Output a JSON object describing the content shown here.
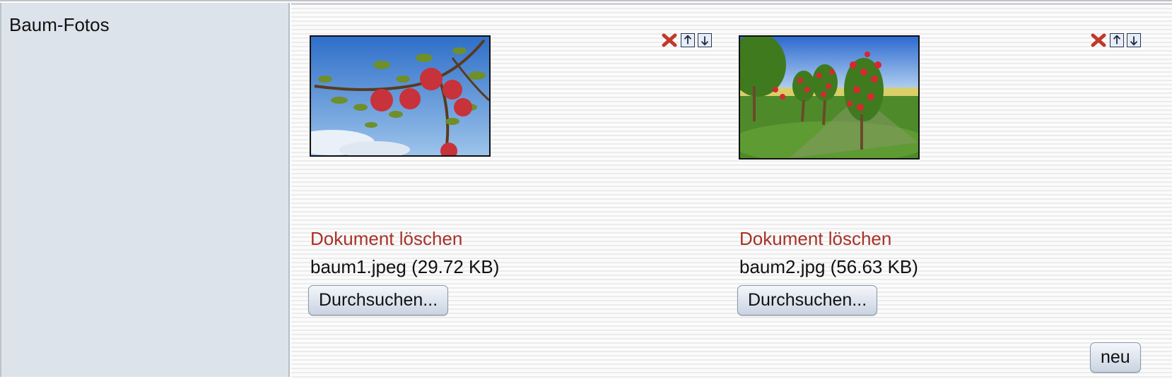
{
  "field": {
    "label": "Baum-Fotos"
  },
  "documents": [
    {
      "image_desc": "apple branch with red apples against blue sky",
      "delete_label": "Dokument löschen",
      "file_info": "baum1.jpeg (29.72 KB)",
      "browse_label": "Durchsuchen...",
      "icons": [
        "delete-x-icon",
        "move-up-icon",
        "move-down-icon"
      ]
    },
    {
      "image_desc": "young apple trees with red apples in orchard",
      "delete_label": "Dokument löschen",
      "file_info": "baum2.jpg (56.63 KB)",
      "browse_label": "Durchsuchen...",
      "icons": [
        "delete-x-icon",
        "move-up-icon",
        "move-down-icon"
      ]
    }
  ],
  "actions": {
    "new_label": "neu"
  },
  "colors": {
    "label_bg": "#dde3eb",
    "delete_link": "#a83228",
    "delete_icon": "#c0392b"
  }
}
